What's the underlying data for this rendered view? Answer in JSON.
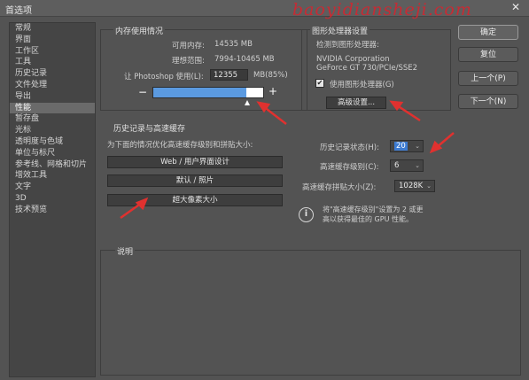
{
  "window": {
    "title": "首选项",
    "close_glyph": "✕"
  },
  "watermark": "baoyidiansheji.com",
  "sidebar": {
    "items": [
      {
        "label": "常规"
      },
      {
        "label": "界面"
      },
      {
        "label": "工作区"
      },
      {
        "label": "工具"
      },
      {
        "label": "历史记录"
      },
      {
        "label": "文件处理"
      },
      {
        "label": "导出"
      },
      {
        "label": "性能",
        "active": true
      },
      {
        "label": "暂存盘"
      },
      {
        "label": "光标"
      },
      {
        "label": "透明度与色域"
      },
      {
        "label": "单位与标尺"
      },
      {
        "label": "参考线、网格和切片"
      },
      {
        "label": "增效工具"
      },
      {
        "label": "文字"
      },
      {
        "label": "3D"
      },
      {
        "label": "技术预览"
      }
    ]
  },
  "memory": {
    "title": "内存使用情况",
    "available_label": "可用内存:",
    "available_value": "14535 MB",
    "ideal_label": "理想范围:",
    "ideal_value": "7994-10465 MB",
    "let_label": "让 Photoshop 使用(L):",
    "let_value": "12355",
    "unit_percent": "MB(85%)",
    "minus": "−",
    "plus": "+",
    "usage_percent": 85
  },
  "gpu": {
    "title": "图形处理器设置",
    "detected_label": "检测到图形处理器:",
    "vendor": "NVIDIA Corporation",
    "model": "GeForce GT 730/PCIe/SSE2",
    "use_gpu_label": "使用图形处理器(G)",
    "use_gpu_checked": true,
    "advanced_button": "高级设置..."
  },
  "history_cache": {
    "title": "历史记录与高速缓存",
    "optimize_label": "为下面的情况优化高速缓存级别和拼贴大小:",
    "preset_web": "Web / 用户界面设计",
    "preset_default": "默认 / 照片",
    "preset_huge": "超大像素大小",
    "history_states_label": "历史记录状态(H):",
    "history_states_value": "20",
    "cache_levels_label": "高速缓存级别(C):",
    "cache_levels_value": "6",
    "tile_size_label": "高速缓存拼贴大小(Z):",
    "tile_size_value": "1028K",
    "info_text_line1": "将\"高速缓存级别\"设置为 2 或更",
    "info_text_line2": "高以获得最佳的 GPU 性能。"
  },
  "description": {
    "title": "说明"
  },
  "buttons": {
    "ok": "确定",
    "reset": "复位",
    "prev": "上一个(P)",
    "next": "下一个(N)"
  },
  "icons": {
    "close": "close-icon",
    "check": "checkbox-icon",
    "info": "info-icon",
    "chevron": "chevron-down-icon"
  },
  "colors": {
    "panel": "#535353",
    "accent_bar": "#5b9ae0",
    "highlight": "#3d7bd1",
    "arrow": "#e0312f"
  }
}
